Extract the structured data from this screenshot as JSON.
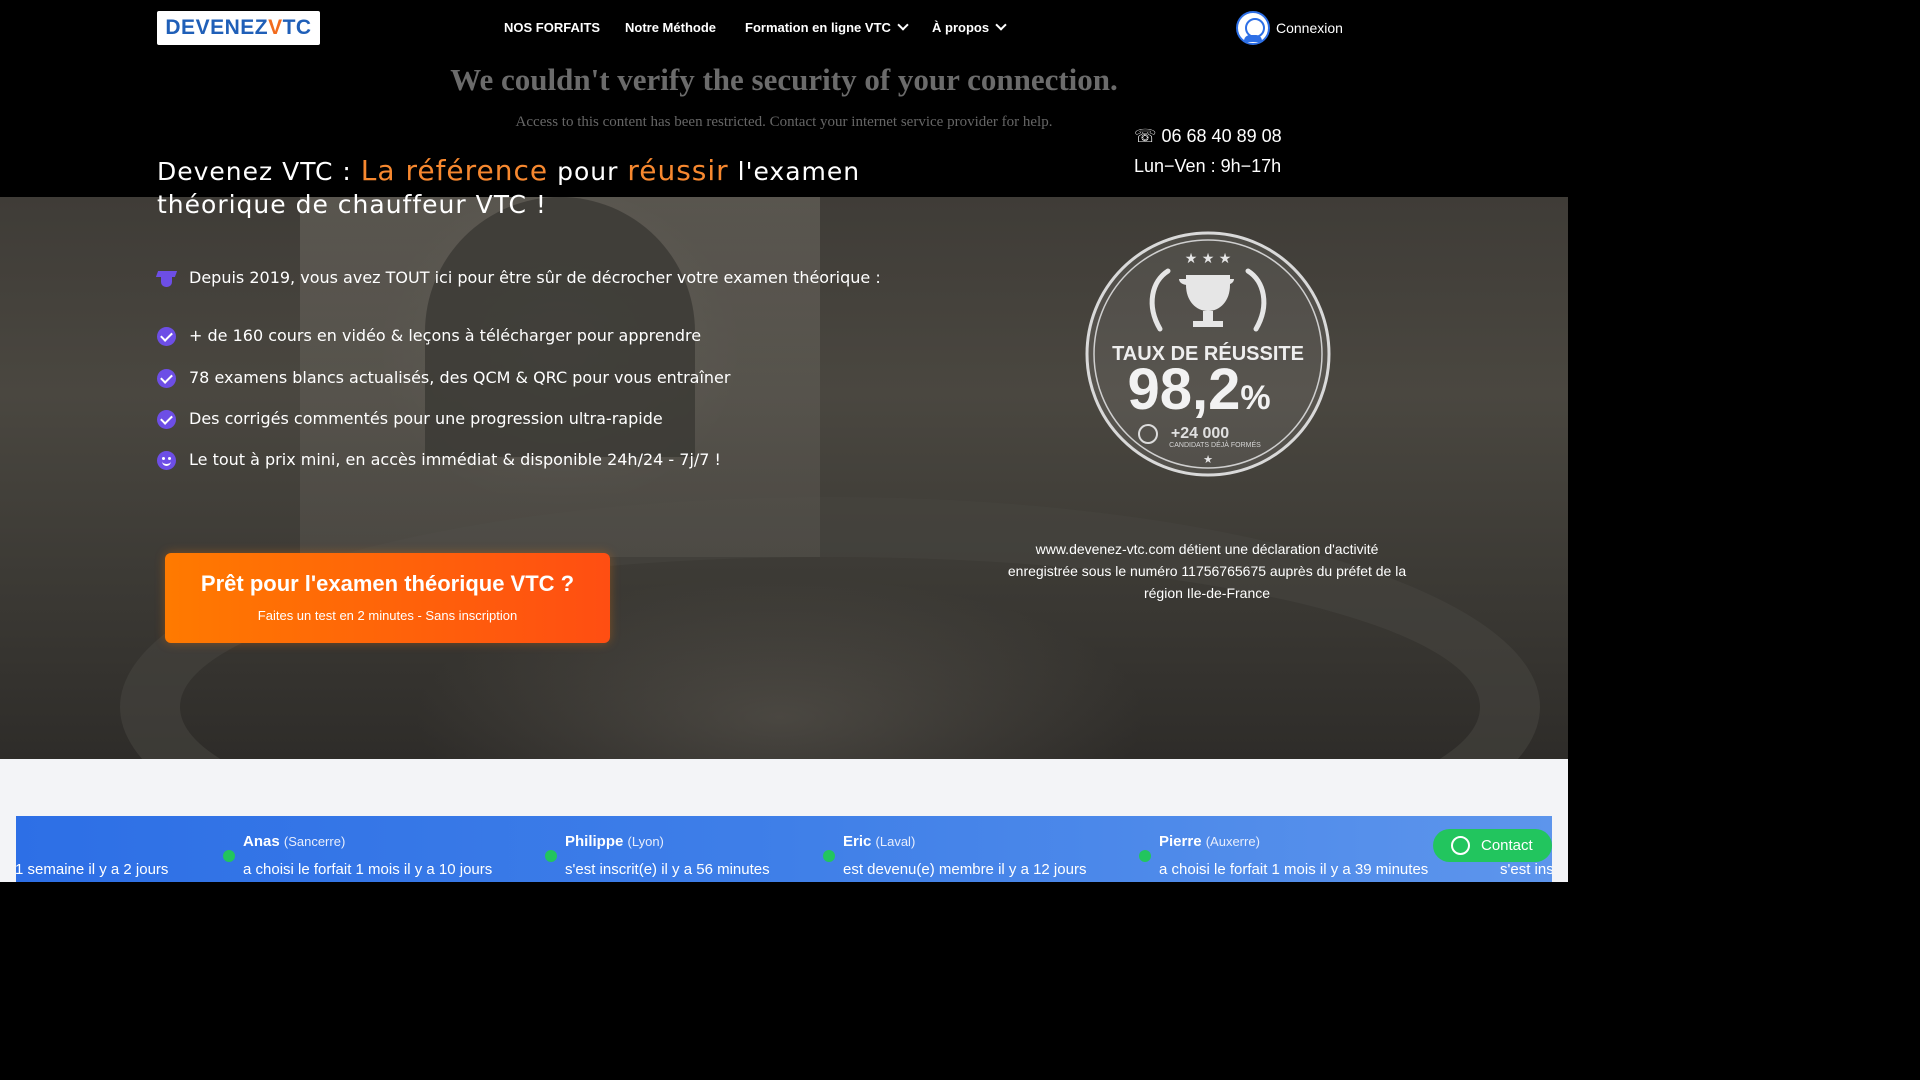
{
  "header": {
    "logo": {
      "part1": "DEVENEZ ",
      "part2": "V",
      "part3": "TC"
    },
    "nav": [
      {
        "label": "NOS FORFAITS"
      },
      {
        "label": "Notre Méthode"
      },
      {
        "label": "Formation en ligne VTC"
      },
      {
        "label": "À propos"
      }
    ],
    "login_label": "Connexion"
  },
  "security_notice": {
    "title": "We couldn't verify the security of your connection.",
    "message": "Access to this content has been restricted. Contact your internet service provider for help."
  },
  "contact_info": {
    "phone": "☏ 06 68 40 89 08",
    "hours": "Lun−Ven : 9h−17h"
  },
  "hero": {
    "headline": {
      "part1": "Devenez VTC : ",
      "highlight1": "La référence",
      "part2": " pour ",
      "highlight2": "réussir",
      "part3": " l'examen théorique de chauffeur VTC !"
    },
    "intro": "Depuis 2019, vous avez TOUT ici pour être sûr de décrocher votre examen théorique :",
    "features": [
      "+ de 160 cours en vidéo & leçons à télécharger pour apprendre",
      "78 examens blancs actualisés, des QCM & QRC pour vous entraîner",
      "Des corrigés commentés pour une progression ultra-rapide",
      "Le tout à prix mini, en accès immédiat & disponible 24h/24 - 7j/7 !"
    ],
    "cta": {
      "title": "Prêt pour l'examen théorique VTC ?",
      "subtitle": "Faites un test en 2 minutes - Sans inscription"
    },
    "badge": {
      "label": "TAUX DE RÉUSSITE",
      "rate": "98,2",
      "rate_unit": "%",
      "candidates": "+24 000",
      "candidates_label": "CANDIDATS DÉJÀ FORMÉS"
    },
    "declaration": "www.devenez-vtc.com détient une déclaration d'activité enregistrée sous le numéro 11756765675 auprès du préfet de la région Ile-de-France"
  },
  "ticker": [
    {
      "name": "",
      "city": "",
      "action": "1 semaine il y a 2 jours"
    },
    {
      "name": "Anas",
      "city": "(Sancerre)",
      "action": "a choisi le forfait 1 mois il y a 10 jours"
    },
    {
      "name": "Philippe",
      "city": "(Lyon)",
      "action": "s'est inscrit(e) il y a 56 minutes"
    },
    {
      "name": "Eric",
      "city": "(Laval)",
      "action": "est devenu(e) membre il y a 12 jours"
    },
    {
      "name": "Pierre",
      "city": "(Auxerre)",
      "action": "a choisi le forfait 1 mois il y a 39 minutes"
    },
    {
      "name": "",
      "city": "",
      "action": "s'est ins"
    }
  ],
  "contact_button": {
    "label": "Contact"
  }
}
